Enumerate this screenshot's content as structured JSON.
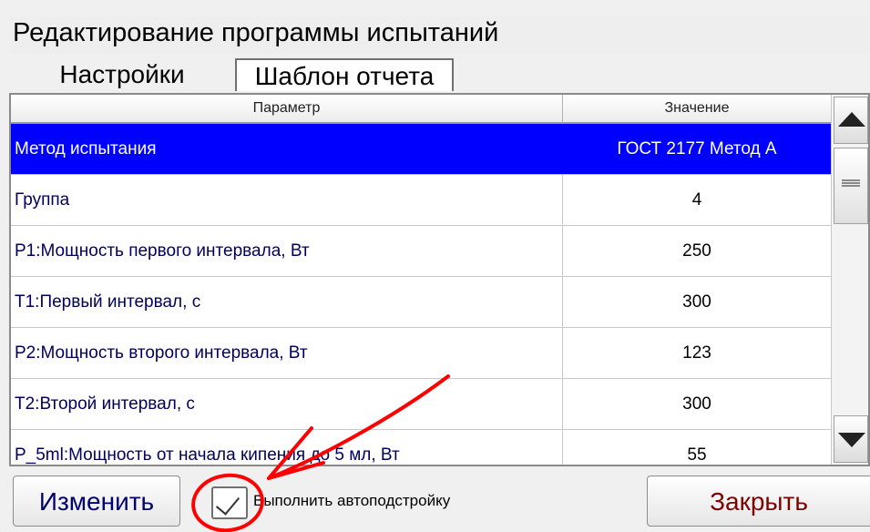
{
  "window": {
    "title": "Редактирование программы испытаний"
  },
  "tabs": [
    {
      "label": "Настройки",
      "active": true
    },
    {
      "label": "Шаблон отчета",
      "active": false
    }
  ],
  "table": {
    "headers": {
      "parameter": "Параметр",
      "value": "Значение"
    },
    "rows": [
      {
        "parameter": "Метод испытания",
        "value": "ГОСТ 2177 Метод А",
        "selected": true
      },
      {
        "parameter": "Группа",
        "value": "4",
        "selected": false
      },
      {
        "parameter": "P1:Мощность первого интервала, Вт",
        "value": "250",
        "selected": false
      },
      {
        "parameter": "T1:Первый интервал, с",
        "value": "300",
        "selected": false
      },
      {
        "parameter": "P2:Мощность второго интервала, Вт",
        "value": "123",
        "selected": false
      },
      {
        "parameter": "T2:Второй интервал, с",
        "value": "300",
        "selected": false
      },
      {
        "parameter": "P_5ml:Мощность от начала кипения до 5 мл, Вт",
        "value": "55",
        "selected": false
      }
    ]
  },
  "footer": {
    "change_label": "Изменить",
    "autotune_label": "Выполнить автоподстройку",
    "autotune_checked": true,
    "close_label": "Закрыть"
  },
  "colors": {
    "selection": "#0000ff",
    "annotation": "#ff0000",
    "change_text": "#000070",
    "close_text": "#800000"
  },
  "icons": {
    "scroll_up": "triangle-up-icon",
    "scroll_down": "triangle-down-icon",
    "scroll_grip": "grip-lines-icon",
    "check": "check-mark-icon"
  }
}
